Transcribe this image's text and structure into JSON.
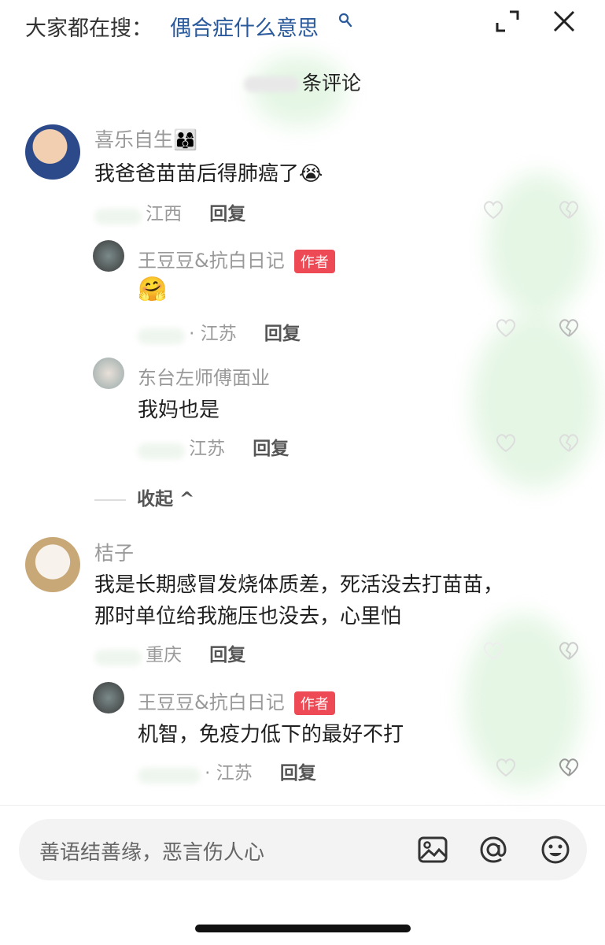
{
  "header": {
    "trending_label": "大家都在搜：",
    "trending_query": "偶合症什么意思",
    "comment_count_title": "条评论"
  },
  "comments": [
    {
      "name": "喜乐自生👨‍👩‍👦",
      "text": "我爸爸苗苗后得肺癌了😭",
      "location": "江西",
      "reply_label": "回复",
      "replies": [
        {
          "name": "王豆豆&抗白日记",
          "badge": "作者",
          "text": "🤗",
          "location": "· 江苏",
          "reply_label": "回复"
        },
        {
          "name": "东台左师傅面业",
          "text": "我妈也是",
          "location": "江苏",
          "reply_label": "回复"
        }
      ],
      "collapse_label": "收起 ^"
    },
    {
      "name": "桔子",
      "text_line1": "我是长期感冒发烧体质差，死活没去打苗苗，",
      "text_line2": "那时单位给我施压也没去，心里怕",
      "location": "重庆",
      "reply_label": "回复",
      "replies": [
        {
          "name": "王豆豆&抗白日记",
          "badge": "作者",
          "text": "机智，免疫力低下的最好不打",
          "location": "· 江苏",
          "reply_label": "回复"
        }
      ]
    }
  ],
  "input": {
    "placeholder": "善语结善缘，恶言伤人心"
  },
  "icons": {
    "search": "search-icon",
    "expand": "expand-icon",
    "close": "close-icon",
    "image": "image-icon",
    "at": "at-icon",
    "emoji": "emoji-icon",
    "heart": "heart-icon",
    "broken_heart": "broken-heart-icon"
  },
  "colors": {
    "query_link": "#2a5a9c",
    "author_badge": "#ee4a55"
  }
}
